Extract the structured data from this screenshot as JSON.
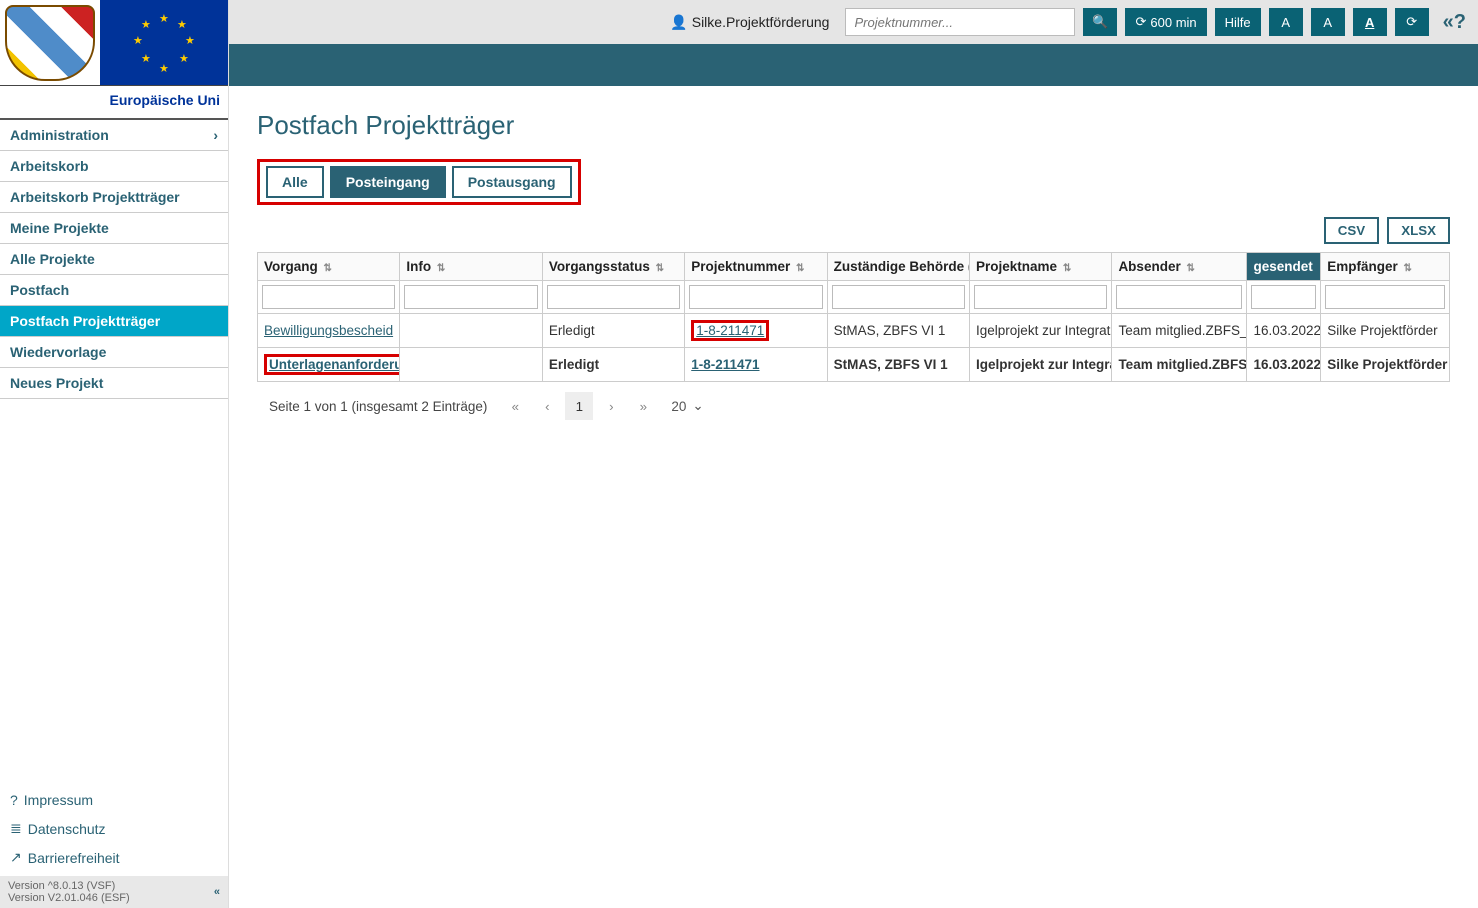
{
  "sidebar": {
    "eu_label": "Europäische Uni",
    "nav": [
      {
        "label": "Administration",
        "has_children": true
      },
      {
        "label": "Arbeitskorb"
      },
      {
        "label": "Arbeitskorb Projektträger"
      },
      {
        "label": "Meine Projekte"
      },
      {
        "label": "Alle Projekte"
      },
      {
        "label": "Postfach"
      },
      {
        "label": "Postfach Projektträger",
        "active": true
      },
      {
        "label": "Wiedervorlage"
      },
      {
        "label": "Neues Projekt"
      }
    ],
    "footer": [
      {
        "icon": "?",
        "label": "Impressum"
      },
      {
        "icon": "≣",
        "label": "Datenschutz"
      },
      {
        "icon": "↗",
        "label": "Barrierefreiheit"
      }
    ],
    "version1": "Version ^8.0.13 (VSF)",
    "version2": "Version V2.01.046 (ESF)",
    "collapse": "«"
  },
  "topbar": {
    "user": "Silke.Projektförderung",
    "search_placeholder": "Projektnummer...",
    "timeout": "600 min",
    "help": "Hilfe",
    "a1": "A",
    "a2": "A",
    "a3": "A",
    "overflow": "«?"
  },
  "page": {
    "title": "Postfach Projektträger",
    "tabs": [
      "Alle",
      "Posteingang",
      "Postausgang"
    ],
    "active_tab": 1,
    "exports": [
      "CSV",
      "XLSX"
    ]
  },
  "table": {
    "columns": [
      "Vorgang",
      "Info",
      "Vorgangsstatus",
      "Projektnummer",
      "Zuständige Behörde (",
      "Projektname",
      "Absender",
      "gesendet",
      "Empfänger"
    ],
    "sorted_col": 7,
    "rows": [
      {
        "vorgang": "Bewilligungsbescheid",
        "info": "",
        "status": "Erledigt",
        "projektnr": "1-8-211471",
        "behoerde": "StMAS, ZBFS VI 1",
        "projektname": "Igelprojekt zur Integrat",
        "absender": "Team mitglied.ZBFS_",
        "gesendet": "16.03.2022",
        "empfaenger": "Silke Projektförder",
        "bold": false,
        "red_vorgang": false,
        "red_projnr": true
      },
      {
        "vorgang": "Unterlagenanforderun",
        "info": "",
        "status": "Erledigt",
        "projektnr": "1-8-211471",
        "behoerde": "StMAS, ZBFS VI 1",
        "projektname": "Igelprojekt zur Integrat",
        "absender": "Team mitglied.ZBFS_",
        "gesendet": "16.03.2022",
        "empfaenger": "Silke Projektförder",
        "bold": true,
        "red_vorgang": true,
        "red_projnr": false
      }
    ]
  },
  "pager": {
    "summary": "Seite 1 von 1 (insgesamt 2 Einträge)",
    "current_page": "1",
    "page_size": "20"
  }
}
